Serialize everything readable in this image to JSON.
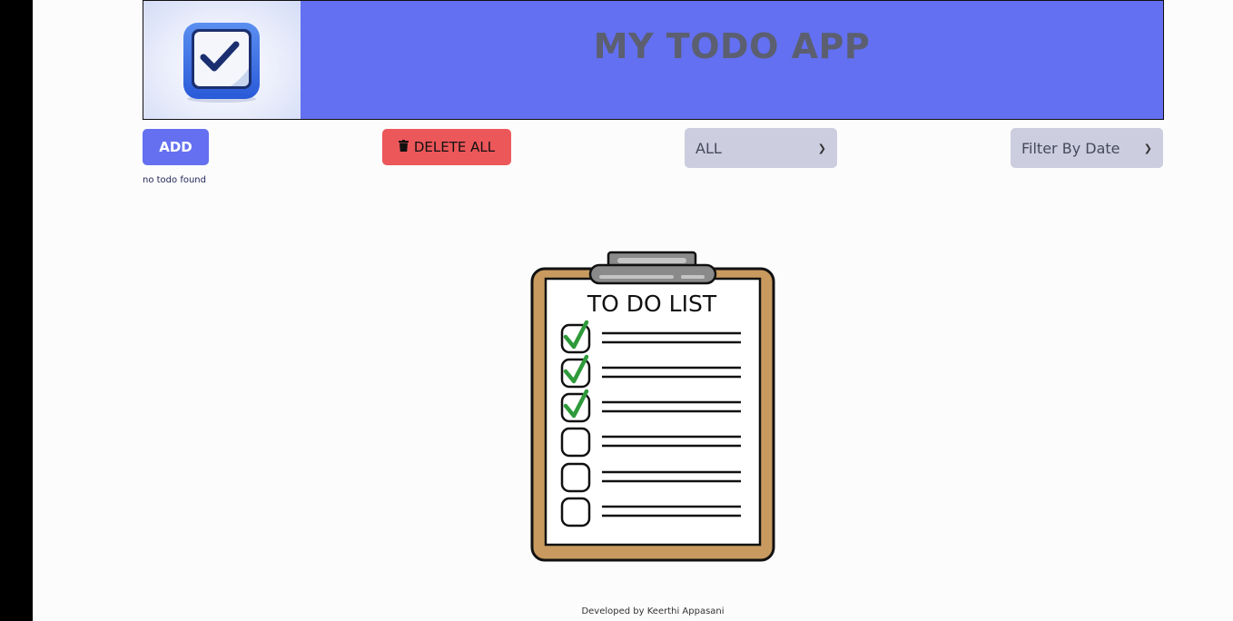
{
  "header": {
    "title": "MY TODO APP",
    "logo_icon": "checkbox-logo-icon"
  },
  "toolbar": {
    "add_label": "ADD",
    "delete_all_label": "DELETE ALL",
    "delete_icon": "trash-icon",
    "status_filter_value": "ALL",
    "date_filter_value": "Filter By Date"
  },
  "main": {
    "empty_message": "no todo found",
    "illustration": {
      "title": "TO DO LIST",
      "checked_items": 3,
      "total_items": 6
    }
  },
  "footer": {
    "credit": "Developed by Keerthi Appasani"
  },
  "colors": {
    "header_bg": "#6370f1",
    "add_button": "#6470f0",
    "delete_button": "#ec575a",
    "select_bg": "#cdcde0"
  }
}
